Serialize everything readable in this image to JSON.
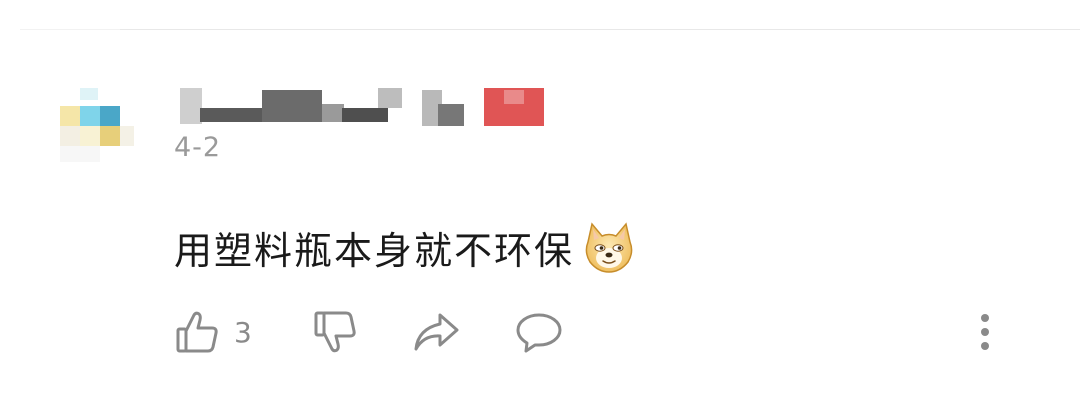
{
  "comment": {
    "author": "",
    "date": "4-2",
    "text": "用塑料瓶本身就不环保",
    "emoji": "doge-emoji"
  },
  "actions": {
    "like_count": "3",
    "like_icon": "thumbs-up-icon",
    "dislike_icon": "thumbs-down-icon",
    "share_icon": "share-arrow-icon",
    "reply_icon": "speech-bubble-icon",
    "more_icon": "vertical-ellipsis-icon"
  },
  "colors": {
    "text": "#1a1a1a",
    "meta": "#9a9a9a",
    "icon": "#8a8a8a",
    "username_redacted_accent": "#e05555"
  }
}
